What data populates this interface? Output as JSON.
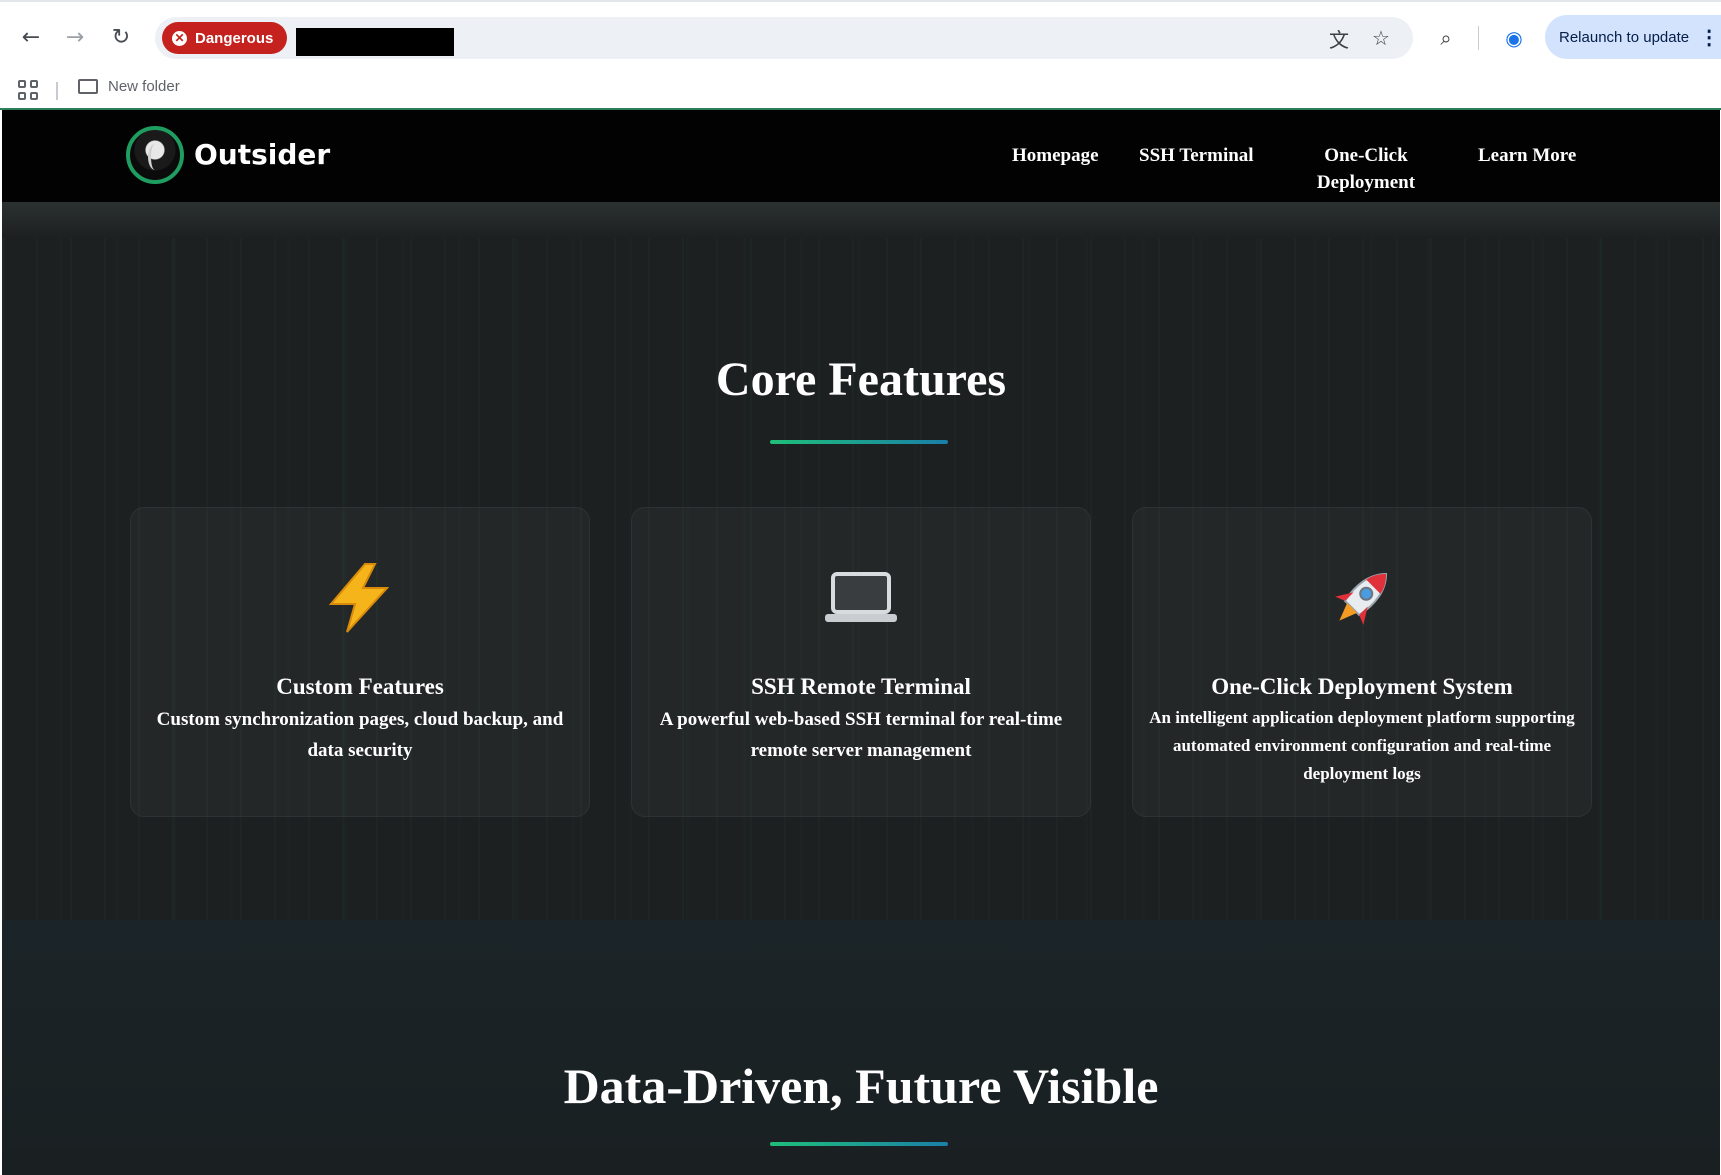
{
  "browser": {
    "security_chip": "Dangerous",
    "relaunch_label": "Relaunch to update",
    "bookmark_folder": "New folder"
  },
  "site": {
    "brand": "Outsider",
    "nav": [
      {
        "label": "Homepage"
      },
      {
        "label": "SSH Terminal"
      },
      {
        "label": "One-Click Deployment"
      },
      {
        "label": "Learn More"
      }
    ],
    "core_title": "Core Features",
    "features": [
      {
        "icon": "lightning-icon",
        "title": "Custom Features",
        "desc": "Custom synchronization pages, cloud backup, and data security"
      },
      {
        "icon": "laptop-icon",
        "title": "SSH Remote Terminal",
        "desc": "A powerful web-based SSH terminal for real-time remote server management"
      },
      {
        "icon": "rocket-icon",
        "title": "One-Click Deployment System",
        "desc": "An intelligent application deployment platform supporting automated environment configuration and real-time deployment logs"
      }
    ],
    "data_title": "Data-Driven, Future Visible"
  },
  "colors": {
    "accent_green": "#1fbf7a",
    "accent_blue": "#1a7fa8",
    "danger": "#c5221f",
    "header_bg": "#020202",
    "page_bg": "#1d2021"
  }
}
